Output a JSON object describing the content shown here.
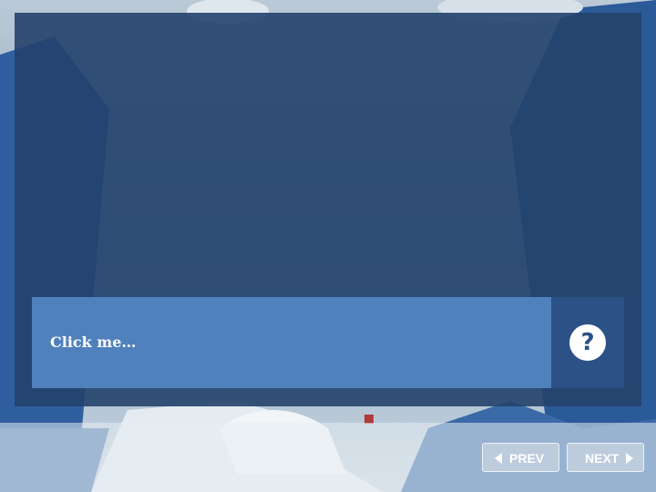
{
  "slide": {
    "click_prompt": "Click me…",
    "help_icon": "question-mark-icon",
    "help_glyph": "?"
  },
  "nav": {
    "prev_label": "PREV",
    "next_label": "NEXT",
    "prev_icon": "triangle-left-icon",
    "next_icon": "triangle-right-icon"
  },
  "colors": {
    "overlay": "#23436c",
    "click_bar": "#5081bd",
    "help_box": "#2b5187",
    "text": "#ffffff"
  }
}
